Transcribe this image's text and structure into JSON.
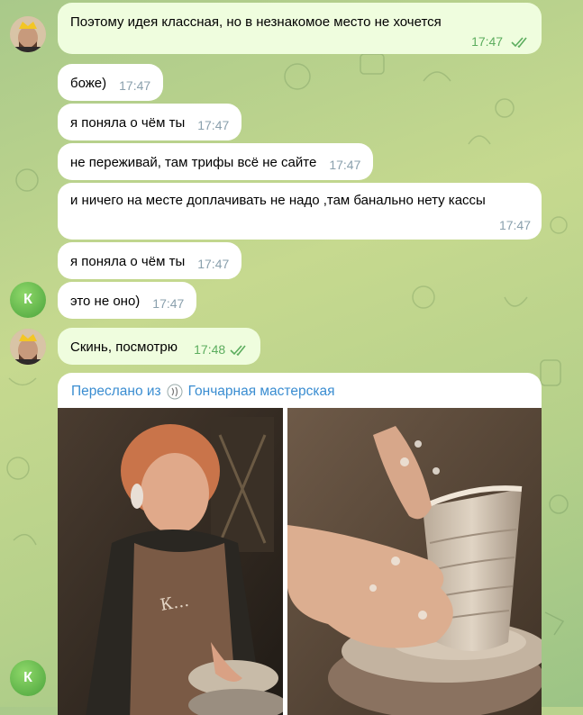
{
  "messages": [
    {
      "text": "Поэтому идея классная, но в незнакомое место не хочется",
      "time": "17:47",
      "outgoing": true
    },
    {
      "text": "боже)",
      "time": "17:47",
      "outgoing": false
    },
    {
      "text": "я поняла о чём ты",
      "time": "17:47",
      "outgoing": false
    },
    {
      "text": "не переживай, там трифы всё не сайте",
      "time": "17:47",
      "outgoing": false
    },
    {
      "text": "и ничего на месте доплачивать не надо ,там банально нету кассы",
      "time": "17:47",
      "outgoing": false
    },
    {
      "text": "я поняла о чём ты",
      "time": "17:47",
      "outgoing": false
    },
    {
      "text": "это не оно)",
      "time": "17:47",
      "outgoing": false
    },
    {
      "text": "Скинь, посмотрю",
      "time": "17:48",
      "outgoing": true
    }
  ],
  "avatar_letter": "К",
  "forwarded": {
    "prefix": "Переслано из",
    "channel": "Гончарная мастерская"
  },
  "colors": {
    "accent": "#3a8dd1",
    "outgoing_bubble": "#effdde",
    "incoming_bubble": "#ffffff",
    "read_ticks": "#5cad5e"
  }
}
